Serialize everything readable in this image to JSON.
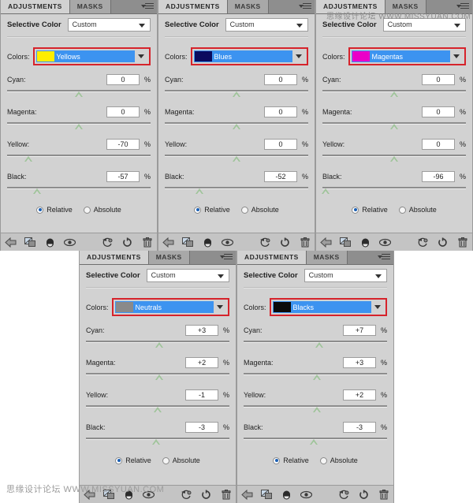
{
  "tabs": {
    "adjustments": "ADJUSTMENTS",
    "masks": "MASKS"
  },
  "header": {
    "title": "Selective Color",
    "preset": "Custom"
  },
  "labels": {
    "colors": "Colors:",
    "cyan": "Cyan:",
    "magenta": "Magenta:",
    "yellow": "Yellow:",
    "black": "Black:",
    "percent": "%",
    "relative": "Relative",
    "absolute": "Absolute"
  },
  "watermark": {
    "top": "思缘设计论坛 WWW.MISSYUAN.COM",
    "bottom": "思缘设计论坛 WWW.MISSYUAN.COM"
  },
  "toolbar_icons": [
    "return-arrow-icon",
    "clip-to-layer-icon",
    "toggle-layer-visibility-icon",
    "preview-eye-icon",
    "view-previous-state-icon",
    "reset-adjustment-icon",
    "delete-adjustment-icon"
  ],
  "panels": [
    {
      "id": "yellows",
      "color_name": "Yellows",
      "swatch": "#ffee00",
      "mode": "Relative",
      "sliders": [
        {
          "name": "Cyan:",
          "value": "0",
          "pos": 50
        },
        {
          "name": "Magenta:",
          "value": "0",
          "pos": 50
        },
        {
          "name": "Yellow:",
          "value": "-70",
          "pos": 15
        },
        {
          "name": "Black:",
          "value": "-57",
          "pos": 21
        }
      ]
    },
    {
      "id": "blues",
      "color_name": "Blues",
      "swatch": "#0b0b5e",
      "mode": "Relative",
      "sliders": [
        {
          "name": "Cyan:",
          "value": "0",
          "pos": 50
        },
        {
          "name": "Magenta:",
          "value": "0",
          "pos": 50
        },
        {
          "name": "Yellow:",
          "value": "0",
          "pos": 50
        },
        {
          "name": "Black:",
          "value": "-52",
          "pos": 24
        }
      ]
    },
    {
      "id": "magentas",
      "color_name": "Magentas",
      "swatch": "#ea00c8",
      "mode": "Relative",
      "sliders": [
        {
          "name": "Cyan:",
          "value": "0",
          "pos": 50
        },
        {
          "name": "Magenta:",
          "value": "0",
          "pos": 50
        },
        {
          "name": "Yellow:",
          "value": "0",
          "pos": 50
        },
        {
          "name": "Black:",
          "value": "-96",
          "pos": 2
        }
      ]
    },
    {
      "id": "neutrals",
      "color_name": "Neutrals",
      "swatch": "#8a8a8a",
      "mode": "Relative",
      "sliders": [
        {
          "name": "Cyan:",
          "value": "+3",
          "pos": 51
        },
        {
          "name": "Magenta:",
          "value": "+2",
          "pos": 51
        },
        {
          "name": "Yellow:",
          "value": "-1",
          "pos": 50
        },
        {
          "name": "Black:",
          "value": "-3",
          "pos": 49
        }
      ]
    },
    {
      "id": "blacks",
      "color_name": "Blacks",
      "swatch": "#0a0a0a",
      "mode": "Relative",
      "sliders": [
        {
          "name": "Cyan:",
          "value": "+7",
          "pos": 53
        },
        {
          "name": "Magenta:",
          "value": "+3",
          "pos": 51
        },
        {
          "name": "Yellow:",
          "value": "+2",
          "pos": 51
        },
        {
          "name": "Black:",
          "value": "-3",
          "pos": 49
        }
      ]
    }
  ]
}
